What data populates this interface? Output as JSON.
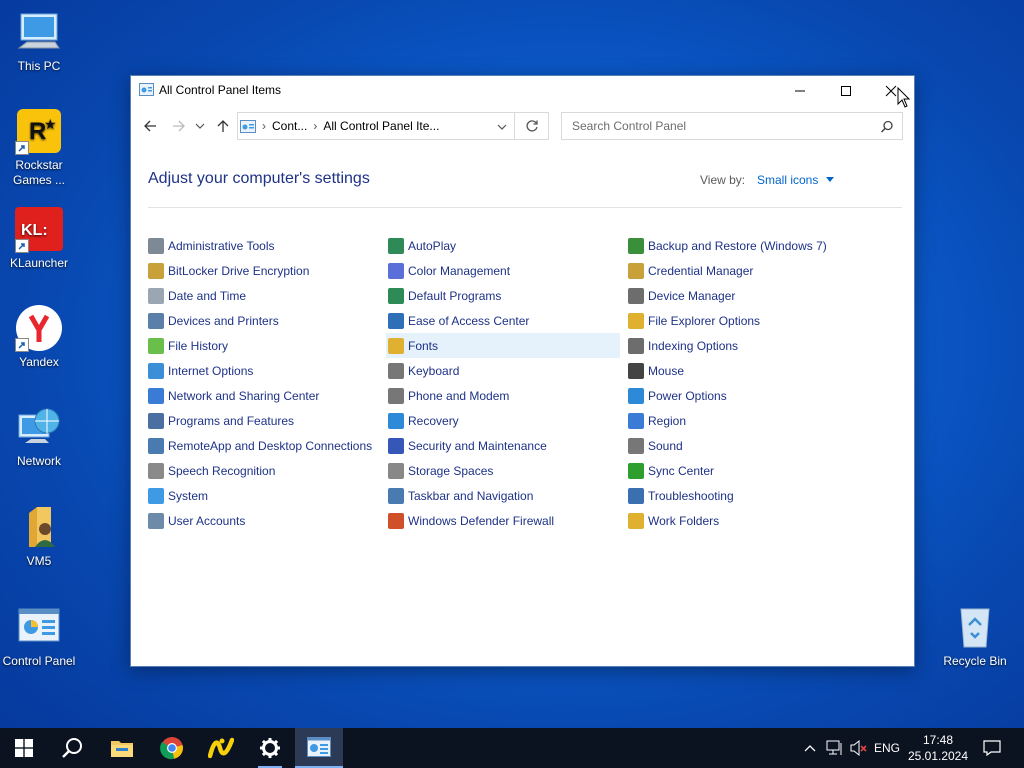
{
  "desktop": {
    "icons": [
      {
        "label": "This PC",
        "icon": "computer-icon"
      },
      {
        "label": "Rockstar Games ...",
        "icon": "rockstar-icon"
      },
      {
        "label": "KLauncher",
        "icon": "klauncher-icon"
      },
      {
        "label": "Yandex",
        "icon": "yandex-icon"
      },
      {
        "label": "Network",
        "icon": "network-icon"
      },
      {
        "label": "VM5",
        "icon": "folder-user-icon"
      },
      {
        "label": "Control Panel",
        "icon": "control-panel-icon"
      },
      {
        "label": "Recycle Bin",
        "icon": "recycle-bin-icon"
      }
    ]
  },
  "window": {
    "title": "All Control Panel Items",
    "address": {
      "crumb1": "Cont...",
      "crumb2": "All Control Panel Ite..."
    },
    "search": {
      "placeholder": "Search Control Panel"
    },
    "heading": "Adjust your computer's settings",
    "view_by_label": "View by:",
    "view_by_value": "Small icons",
    "columns": [
      [
        "Administrative Tools",
        "BitLocker Drive Encryption",
        "Date and Time",
        "Devices and Printers",
        "File History",
        "Internet Options",
        "Network and Sharing Center",
        "Programs and Features",
        "RemoteApp and Desktop Connections",
        "Speech Recognition",
        "System",
        "User Accounts"
      ],
      [
        "AutoPlay",
        "Color Management",
        "Default Programs",
        "Ease of Access Center",
        "Fonts",
        "Keyboard",
        "Phone and Modem",
        "Recovery",
        "Security and Maintenance",
        "Storage Spaces",
        "Taskbar and Navigation",
        "Windows Defender Firewall"
      ],
      [
        "Backup and Restore (Windows 7)",
        "Credential Manager",
        "Device Manager",
        "File Explorer Options",
        "Indexing Options",
        "Mouse",
        "Power Options",
        "Region",
        "Sound",
        "Sync Center",
        "Troubleshooting",
        "Work Folders"
      ]
    ],
    "highlighted_item": "Fonts"
  },
  "taskbar": {
    "language": "ENG",
    "time": "17:48",
    "date": "25.01.2024",
    "pinned": [
      "start-icon",
      "search-icon",
      "file-explorer-icon",
      "chrome-icon",
      "yandex-music-icon",
      "settings-icon",
      "control-panel-icon"
    ]
  },
  "colors": {
    "link": "#1e3287",
    "accent": "#0066cc",
    "hover": "#e5f1fb",
    "taskbar": "#0b1220"
  }
}
